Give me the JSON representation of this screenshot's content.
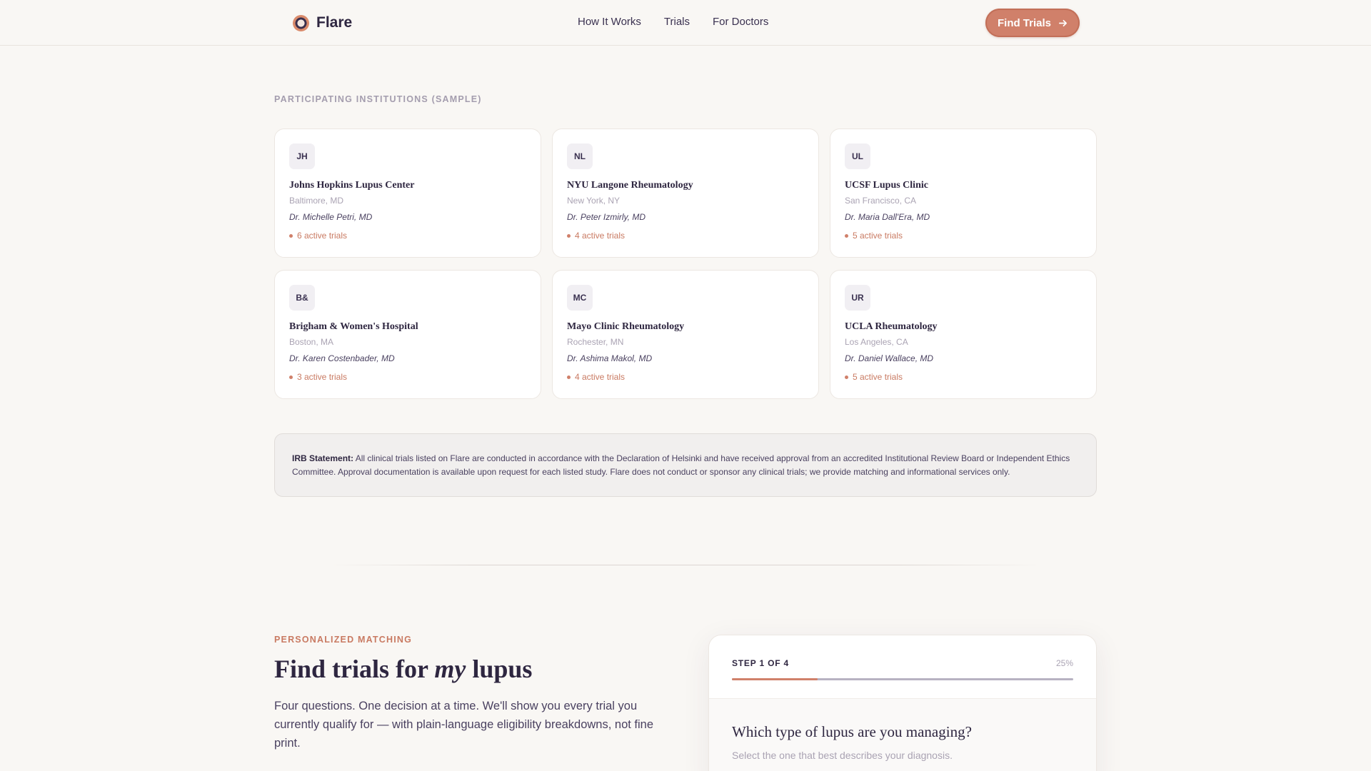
{
  "header": {
    "brand": "Flare",
    "nav": [
      "How It Works",
      "Trials",
      "For Doctors"
    ],
    "cta_label": "Find Trials"
  },
  "institutions": {
    "label": "PARTICIPATING INSTITUTIONS (SAMPLE)",
    "items": [
      {
        "initials": "JH",
        "name": "Johns Hopkins Lupus Center",
        "location": "Baltimore, MD",
        "doctor": "Dr. Michelle Petri, MD",
        "trials": "6 active trials"
      },
      {
        "initials": "NL",
        "name": "NYU Langone Rheumatology",
        "location": "New York, NY",
        "doctor": "Dr. Peter Izmirly, MD",
        "trials": "4 active trials"
      },
      {
        "initials": "UL",
        "name": "UCSF Lupus Clinic",
        "location": "San Francisco, CA",
        "doctor": "Dr. Maria Dall'Era, MD",
        "trials": "5 active trials"
      },
      {
        "initials": "B&",
        "name": "Brigham & Women's Hospital",
        "location": "Boston, MA",
        "doctor": "Dr. Karen Costenbader, MD",
        "trials": "3 active trials"
      },
      {
        "initials": "MC",
        "name": "Mayo Clinic Rheumatology",
        "location": "Rochester, MN",
        "doctor": "Dr. Ashima Makol, MD",
        "trials": "4 active trials"
      },
      {
        "initials": "UR",
        "name": "UCLA Rheumatology",
        "location": "Los Angeles, CA",
        "doctor": "Dr. Daniel Wallace, MD",
        "trials": "5 active trials"
      }
    ]
  },
  "irb": {
    "heading": "IRB Statement:",
    "text": "All clinical trials listed on Flare are conducted in accordance with the Declaration of Helsinki and have received approval from an accredited Institutional Review Board or Independent Ethics Committee. Approval documentation is available upon request for each listed study. Flare does not conduct or sponsor any clinical trials; we provide matching and informational services only."
  },
  "matching": {
    "eyebrow": "PERSONALIZED MATCHING",
    "title_pre": "Find trials for ",
    "title_em": "my",
    "title_post": " lupus",
    "lead": "Four questions. One decision at a time. We'll show you every trial you currently qualify for — with plain-language eligibility breakdowns, not fine print.",
    "step_label": "STEP 1 OF 4",
    "percent_label": "25%",
    "progress": 0.25,
    "question": "Which type of lupus are you managing?",
    "question_sub": "Select the one that best describes your diagnosis."
  },
  "colors": {
    "accent": "#d0806a",
    "text": "#2e2640",
    "background": "#f9f7f4"
  }
}
